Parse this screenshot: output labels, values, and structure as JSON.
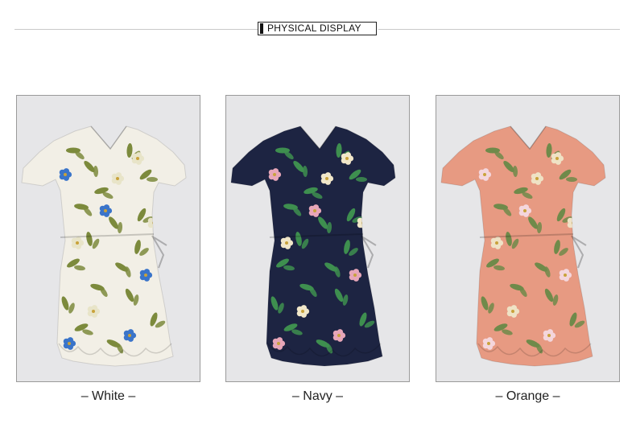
{
  "header": {
    "title": "PHYSICAL DISPLAY"
  },
  "products": [
    {
      "label": "– White –",
      "dress_color": "#f2efe6",
      "leaf_color": "#7c8a3c",
      "flower_color": "#3a74c9",
      "flower2_color": "#e8e4c8"
    },
    {
      "label": "– Navy –",
      "dress_color": "#1d2442",
      "leaf_color": "#3e8f4f",
      "flower_color": "#e7a6b8",
      "flower2_color": "#f1e7c9"
    },
    {
      "label": "– Orange –",
      "dress_color": "#e79a82",
      "leaf_color": "#6f8a4a",
      "flower_color": "#f4d6dc",
      "flower2_color": "#efe2c5"
    }
  ]
}
